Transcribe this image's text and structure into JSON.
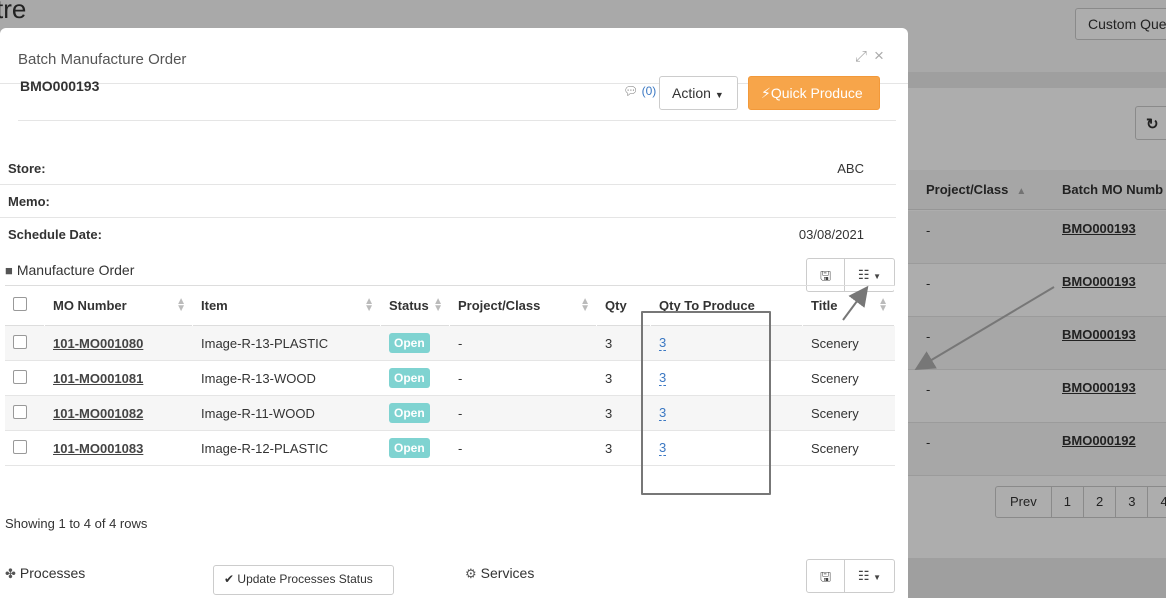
{
  "background": {
    "heading": "tre",
    "custom_button": "Custom Que",
    "refresh_icon": "refresh-icon",
    "columns": [
      "Project/Class",
      "Batch MO Numb"
    ],
    "rows": [
      {
        "project": "-",
        "batch": "BMO000193"
      },
      {
        "project": "-",
        "batch": "BMO000193"
      },
      {
        "project": "-",
        "batch": "BMO000193"
      },
      {
        "project": "-",
        "batch": "BMO000193"
      },
      {
        "project": "-",
        "batch": "BMO000192"
      }
    ],
    "pager": [
      "Prev",
      "1",
      "2",
      "3",
      "4"
    ]
  },
  "modal": {
    "title": "Batch Manufacture Order",
    "order_number": "BMO000193",
    "comment_count": "(0)",
    "action_label": "Action",
    "quick_produce_label": "Quick Produce",
    "info": [
      {
        "label": "Store:",
        "value": "ABC"
      },
      {
        "label": "Memo:",
        "value": ""
      },
      {
        "label": "Schedule Date:",
        "value": "03/08/2021"
      }
    ],
    "mo_section_title": "Manufacture Order",
    "table": {
      "headers": [
        "MO Number",
        "Item",
        "Status",
        "Project/Class",
        "Qty",
        "Qty To Produce",
        "Title"
      ],
      "rows": [
        {
          "mo": "101-MO001080",
          "item": "Image-R-13-PLASTIC",
          "status": "Open",
          "project": "-",
          "qty": "3",
          "to_produce": "3",
          "title": "Scenery"
        },
        {
          "mo": "101-MO001081",
          "item": "Image-R-13-WOOD",
          "status": "Open",
          "project": "-",
          "qty": "3",
          "to_produce": "3",
          "title": "Scenery"
        },
        {
          "mo": "101-MO001082",
          "item": "Image-R-11-WOOD",
          "status": "Open",
          "project": "-",
          "qty": "3",
          "to_produce": "3",
          "title": "Scenery"
        },
        {
          "mo": "101-MO001083",
          "item": "Image-R-12-PLASTIC",
          "status": "Open",
          "project": "-",
          "qty": "3",
          "to_produce": "3",
          "title": "Scenery"
        }
      ],
      "footer": "Showing 1 to 4 of 4 rows"
    },
    "processes_title": "Processes",
    "update_processes_label": "Update Processes Status",
    "services_title": "Services"
  },
  "colors": {
    "quick_produce": "#f7a54a",
    "status_open": "#7fd3d1",
    "link_blue": "#3b78c3"
  }
}
